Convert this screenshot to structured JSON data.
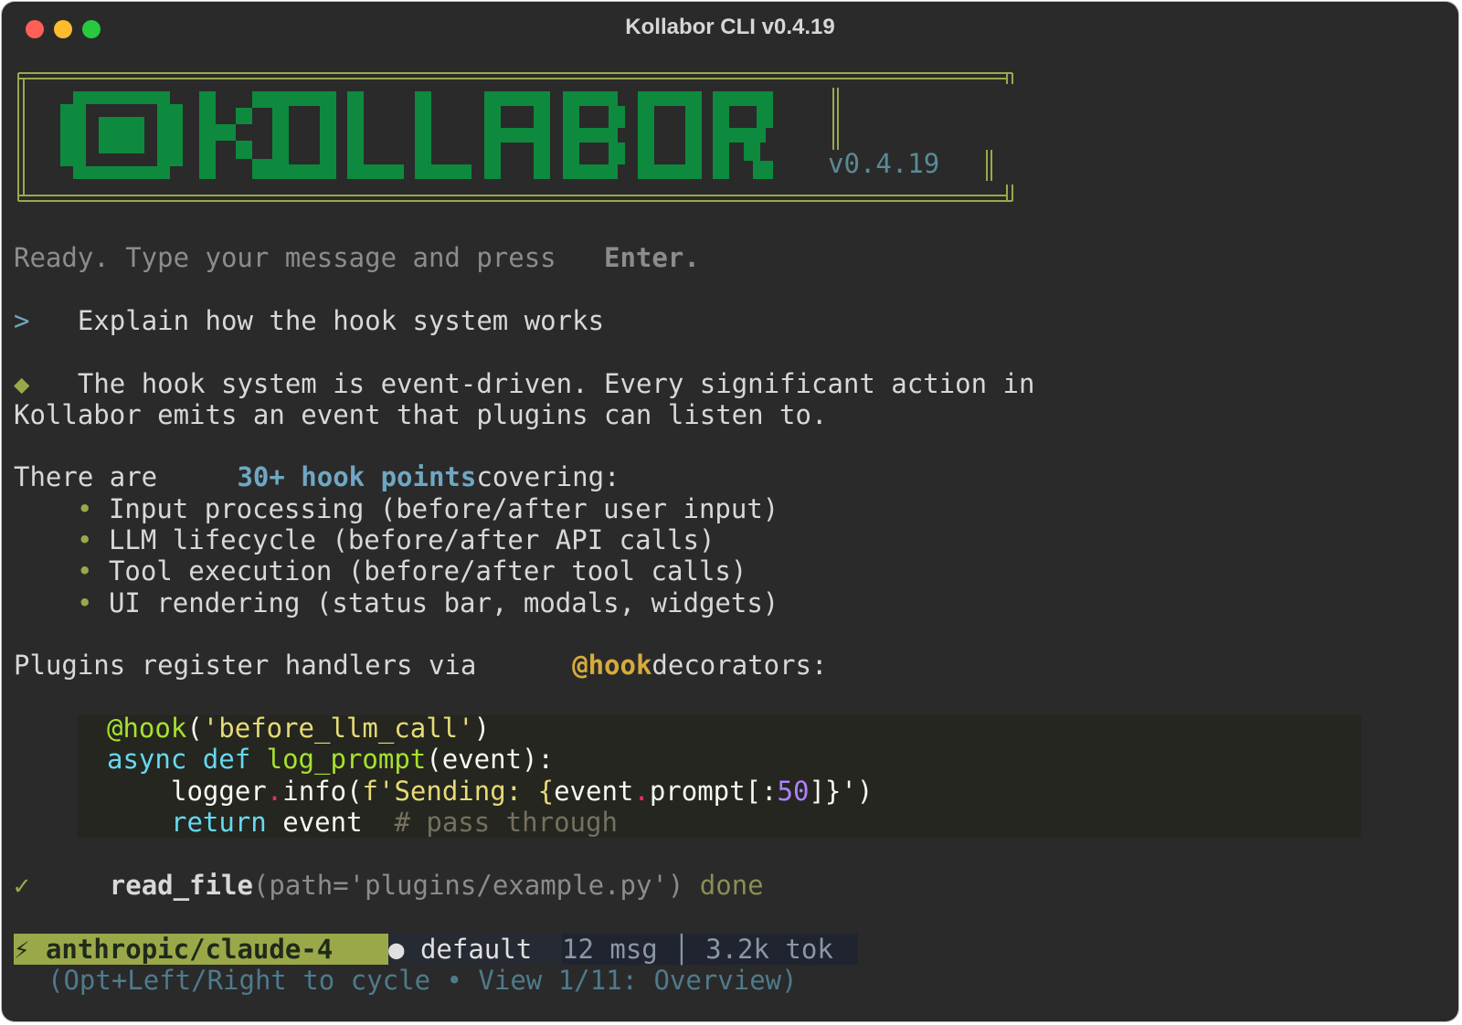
{
  "window": {
    "title": "Kollabor CLI v0.4.19"
  },
  "banner": {
    "logo_text": "KOLLABOR",
    "version": "v0.4.19"
  },
  "ready": {
    "text": "Ready. Type your message and press ",
    "key": "Enter."
  },
  "user_message": {
    "prompt_symbol": ">",
    "text": "Explain how the hook system works"
  },
  "assistant": {
    "marker": "◆",
    "line1": "The hook system is event-driven. Every significant action in",
    "line2": "Kollabor emits an event that plugins can listen to.",
    "there_are_prefix": "There are ",
    "there_are_highlight": "30+ hook points",
    "there_are_suffix": "covering:",
    "bullet_symbol": "•",
    "bullets": [
      "Input processing (before/after user input)",
      "LLM lifecycle (before/after API calls)",
      "Tool execution (before/after tool calls)",
      "UI rendering (status bar, modals, widgets)"
    ],
    "plugins_prefix": "Plugins register handlers via ",
    "plugins_highlight": "@hook",
    "plugins_suffix": "decorators:"
  },
  "code": {
    "decorator": "@hook",
    "decorator_open": "(",
    "decorator_arg": "'before_llm_call'",
    "decorator_close": ")",
    "kw_async": "async",
    "kw_def": "def",
    "fn_name": "log_prompt",
    "params": "(event):",
    "logger": "logger",
    "dot": ".",
    "info_open": "info(",
    "fstring_start": "f'Sending: {",
    "event": "event",
    "prompt_slice": "prompt[:",
    "num": "50",
    "fstring_end": "]}'",
    "close_paren": ")",
    "kw_return": "return",
    "return_val": "event",
    "comment": "# pass through"
  },
  "tool_call": {
    "check": "✓",
    "name": "read_file",
    "args": "(path='plugins/example.py')",
    "status": "done"
  },
  "status_bar": {
    "model_icon": "⚡",
    "model": "anthropic/claude-4",
    "profile_dot": "●",
    "profile": "default",
    "stats": "12 msg │ 3.2k tok"
  },
  "hint": {
    "prefix": "(Opt+Left/Right to cycle • View ",
    "view": "1/11: Overview)"
  },
  "colors": {
    "background": "#2a2a2a",
    "logo_green": "#0d8a3e",
    "frame_olive": "#9aa84a",
    "accent_blue": "#6fa7c3",
    "accent_yellow": "#d7aa3c"
  }
}
